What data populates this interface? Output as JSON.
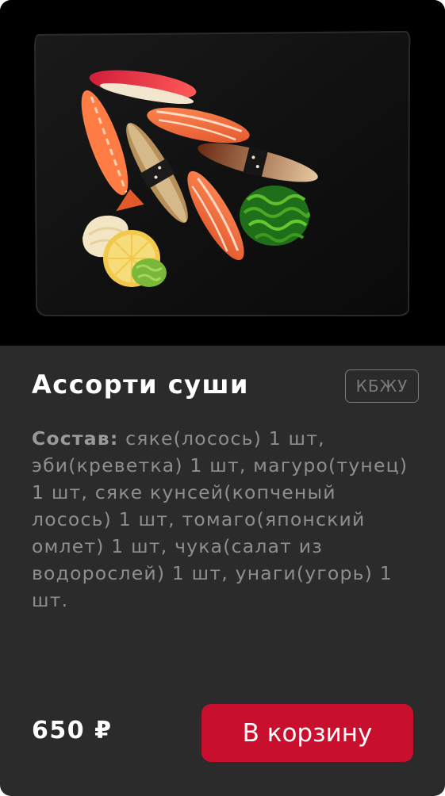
{
  "product": {
    "title": "Ассорти суши",
    "nutrition_button": "КБЖУ",
    "composition_label": "Состав:",
    "composition_text": " сяке(лосось) 1 шт, эби(креветка) 1 шт, магуро(тунец) 1 шт, сяке кунсей(копченый лосось) 1 шт, томаго(японский омлет) 1 шт, чука(салат из водорослей) 1 шт, унаги(угорь) 1 шт.",
    "price": "650 ₽",
    "add_to_cart": "В корзину"
  },
  "colors": {
    "card_background": "#2b2b2b",
    "accent_button": "#c8102e",
    "photo_background": "#000000"
  }
}
